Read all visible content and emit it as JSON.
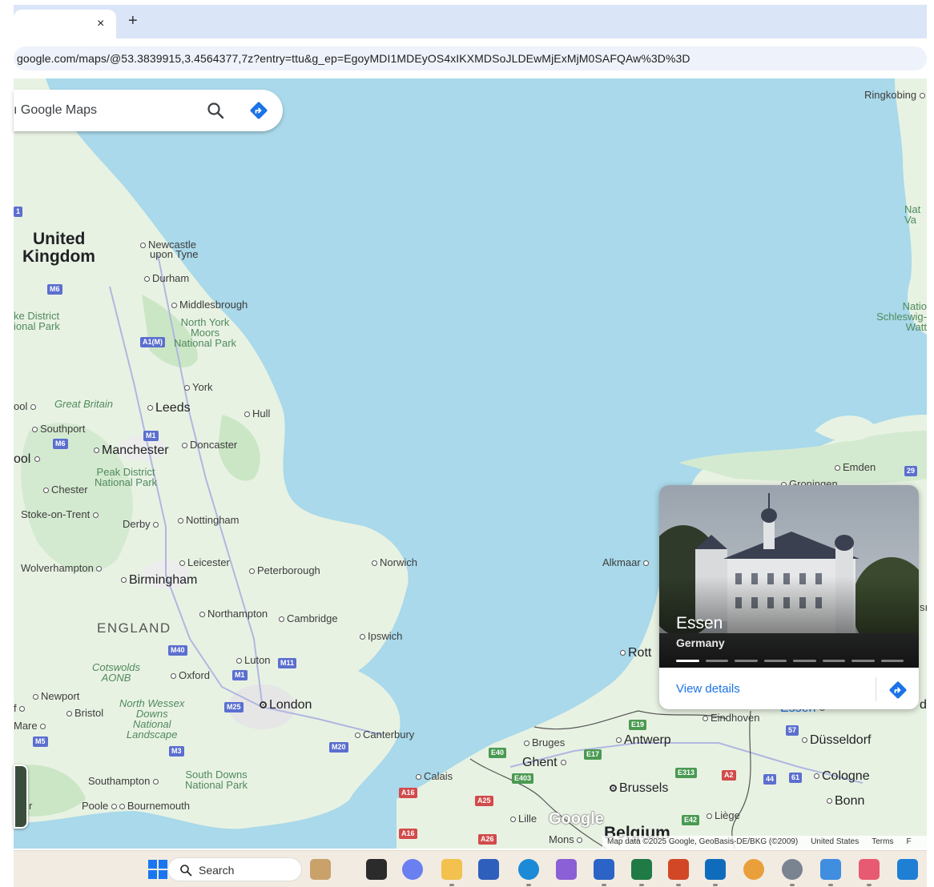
{
  "browser": {
    "tab_close": "×",
    "new_tab": "+",
    "url": "google.com/maps/@53.3839915,3.4564377,7z?entry=ttu&g_ep=EgoyMDI1MDEyOS4xIKXMDSoJLDEwMjExMjM0SAFQAw%3D%3D"
  },
  "search": {
    "placeholder": "ı Google Maps",
    "search_icon": "search-icon",
    "directions_icon": "directions-icon"
  },
  "map_labels": {
    "united_kingdom_1": "United",
    "united_kingdom_2": "Kingdom",
    "newcastle_1": "Newcastle",
    "newcastle_2": "upon Tyne",
    "durham": "Durham",
    "middlesbrough": "Middlesbrough",
    "north_york_1": "North York",
    "north_york_2": "Moors",
    "north_york_3": "National Park",
    "lake_district_1": "ke District",
    "lake_district_2": "ional Park",
    "york": "York",
    "great_britain": "Great Britain",
    "leeds": "Leeds",
    "hull": "Hull",
    "pool": "ool",
    "southport": "Southport",
    "doncaster": "Doncaster",
    "manchester": "Manchester",
    "pool2": "ool",
    "peak_1": "Peak District",
    "peak_2": "National Park",
    "chester": "Chester",
    "stoke": "Stoke-on-Trent",
    "derby": "Derby",
    "nottingham": "Nottingham",
    "leicester": "Leicester",
    "norwich": "Norwich",
    "peterborough": "Peterborough",
    "wolverhampton": "Wolverhampton",
    "birmingham": "Birmingham",
    "northampton": "Northampton",
    "cambridge": "Cambridge",
    "england": "ENGLAND",
    "ipswich": "Ipswich",
    "cotswolds_1": "Cotswolds",
    "cotswolds_2": "AONB",
    "oxford": "Oxford",
    "luton": "Luton",
    "newport": "Newport",
    "nw_1": "North Wessex",
    "nw_2": "Downs",
    "nw_3": "National",
    "nw_4": "Landscape",
    "bristol": "Bristol",
    "london": "London",
    "f": "f",
    "mare": "Mare",
    "canterbury": "Canterbury",
    "southampton": "Southampton",
    "sd_1": "South Downs",
    "sd_2": "National Park",
    "poole": "Poole",
    "bournemouth": "Bournemouth",
    "r": "r",
    "calais": "Calais",
    "ringkobing": "Ringkobing",
    "nat_1": "Nat",
    "nat_2": "Va",
    "natio_1": "Natio",
    "natio_2": "Schleswig-",
    "natio_3": "Watt",
    "emden": "Emden",
    "groningen": "Groningen",
    "alkmaar": "Alkmaar",
    "rott": "Rott",
    "bruges": "Bruges",
    "antwerp": "Antwerp",
    "ghent": "Ghent",
    "eindhoven": "Eindhoven",
    "essen_lbl": "Essen",
    "dusseldorf": "Düsseldorf",
    "brussels": "Brussels",
    "cologne": "Cologne",
    "bonn": "Bonn",
    "lille": "Lille",
    "liege": "Liège",
    "belgium": "Belgium",
    "mons": "Mons",
    "si": "sı",
    "d": "d"
  },
  "shields": {
    "m6a": "M6",
    "a1m": "A1(M)",
    "m1a": "M1",
    "m6b": "M6",
    "m40": "M40",
    "m11": "M11",
    "m1b": "M1",
    "m25": "M25",
    "m3": "M3",
    "m20": "M20",
    "m5": "M5",
    "m_top": "1",
    "e40": "E40",
    "e17": "E17",
    "e19": "E19",
    "e403": "E403",
    "a16a": "A16",
    "a25": "A25",
    "a16b": "A16",
    "a26": "A26",
    "e313": "E313",
    "a2": "A2",
    "e42": "E42",
    "n44": "44",
    "n61": "61",
    "n57": "57",
    "n29": "29"
  },
  "place_card": {
    "title": "Essen",
    "subtitle": "Germany",
    "link": "View details",
    "photo_count": 8
  },
  "map_footer": {
    "logo": "Google",
    "attribution": "Map data ©2025 Google, GeoBasis-DE/BKG (©2009)",
    "region": "United States",
    "terms": "Terms",
    "f": "F"
  },
  "taskbar": {
    "search_label": "Search",
    "apps": [
      "widgets-icon",
      "task-view-icon",
      "copilot-icon",
      "file-explorer-icon",
      "store-icon",
      "edge-icon",
      "m365-icon",
      "word-icon",
      "excel-icon",
      "powerpoint-icon",
      "outlook-icon",
      "photos-icon",
      "settings-icon",
      "photos-app-icon",
      "snipping-icon",
      "outlook-new-icon"
    ]
  },
  "colors": {
    "water": "#a9d9ea",
    "land": "#e8f2e3",
    "green": "#cbe6c5",
    "accent": "#1a73e8"
  }
}
